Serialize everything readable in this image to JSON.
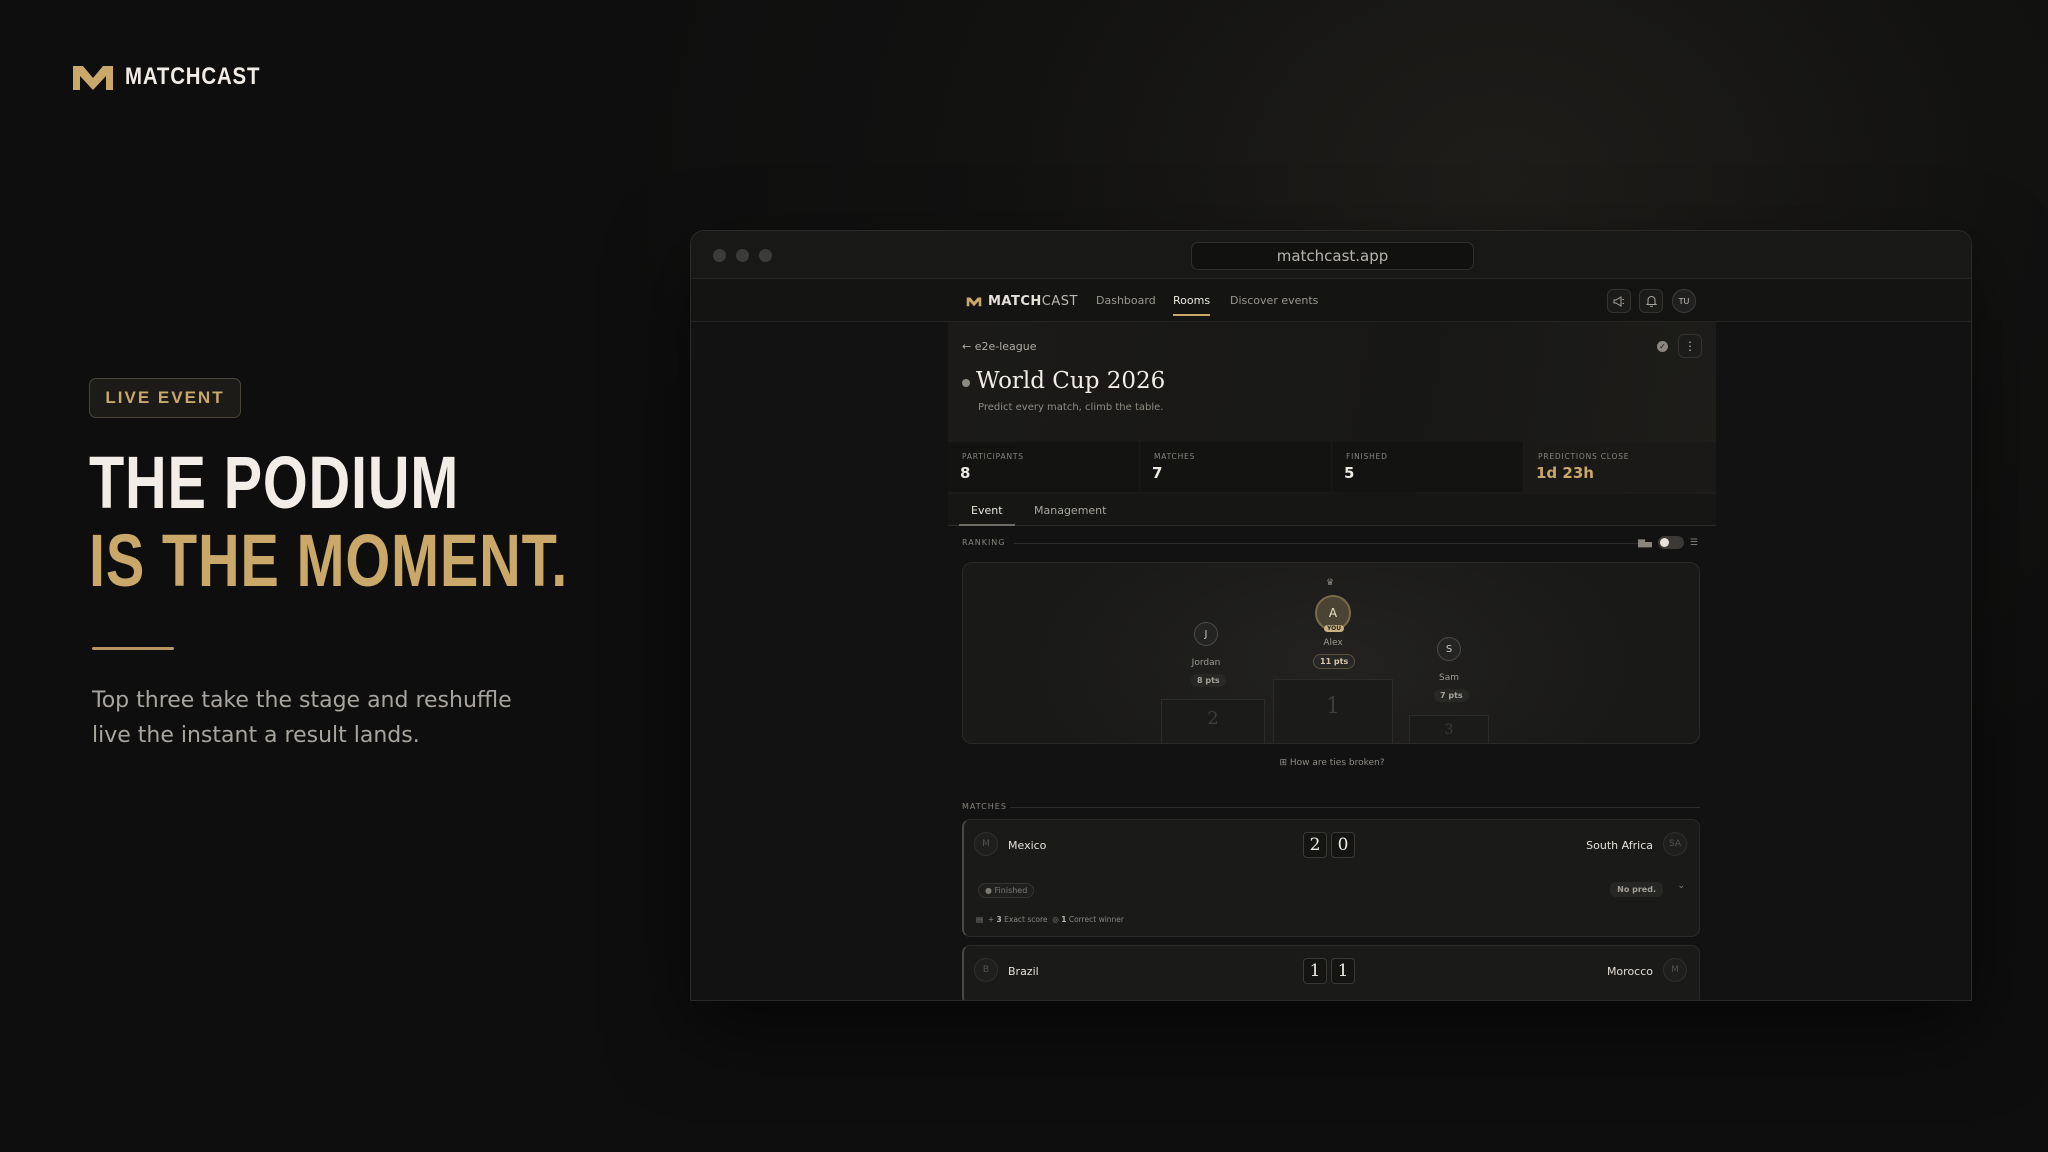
{
  "brand": {
    "name": "MATCHCAST",
    "accent": "#c9a86a"
  },
  "hero": {
    "badge": "LIVE EVENT",
    "headline_line1": "THE PODIUM",
    "headline_line2": "IS THE MOMENT.",
    "tagline": "Top three take the stage and reshuffle live the instant a result lands."
  },
  "browser": {
    "url": "matchcast.app"
  },
  "app": {
    "logo_bold": "MATCH",
    "logo_light": "CAST",
    "nav": [
      "Dashboard",
      "Rooms",
      "Discover events"
    ],
    "active_nav": "Rooms",
    "user_initials": "TU",
    "icons": [
      "megaphone-icon",
      "bell-icon"
    ]
  },
  "room": {
    "back_label": "e2e-league",
    "title": "World Cup 2026",
    "subtitle": "Predict every match, climb the table.",
    "stats": [
      {
        "label": "PARTICIPANTS",
        "value": "8"
      },
      {
        "label": "MATCHES",
        "value": "7"
      },
      {
        "label": "FINISHED",
        "value": "5"
      },
      {
        "label": "PREDICTIONS CLOSE",
        "value": "1d 23h"
      }
    ],
    "tabs": [
      "Event",
      "Management"
    ],
    "active_tab": "Event"
  },
  "ranking": {
    "label": "RANKING",
    "podium": [
      {
        "place": "1",
        "initial": "A",
        "name": "Alex",
        "points": "11 pts",
        "you_tag": "YOU"
      },
      {
        "place": "2",
        "initial": "J",
        "name": "Jordan",
        "points": "8 pts"
      },
      {
        "place": "3",
        "initial": "S",
        "name": "Sam",
        "points": "7 pts"
      }
    ],
    "ties_link": "How are ties broken?"
  },
  "matches": {
    "label": "MATCHES",
    "items": [
      {
        "home": "Mexico",
        "home_initial": "M",
        "away": "South Africa",
        "away_initial": "SA",
        "home_score": "2",
        "away_score": "0",
        "status": "Finished",
        "prediction": "No pred.",
        "exact_count": "3",
        "exact_label": "Exact score",
        "winner_count": "1",
        "winner_label": "Correct winner"
      },
      {
        "home": "Brazil",
        "home_initial": "B",
        "away": "Morocco",
        "away_initial": "M",
        "home_score": "1",
        "away_score": "1"
      }
    ]
  }
}
